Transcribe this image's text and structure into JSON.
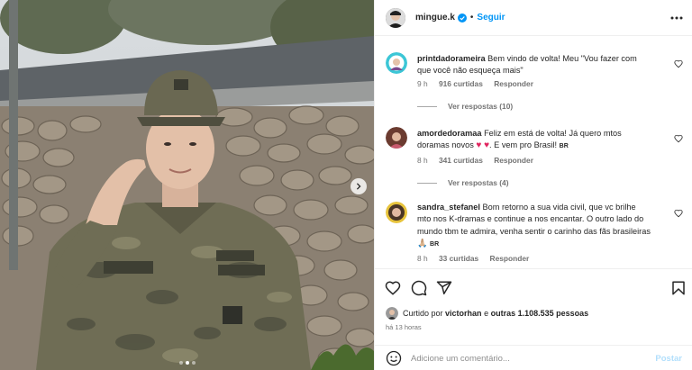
{
  "post": {
    "username": "mingue.k",
    "separator": "•",
    "follow_label": "Seguir",
    "carousel_pages": 3,
    "carousel_active": 1
  },
  "comments": [
    {
      "username": "printdadorameira",
      "text": "Bem vindo de volta! Meu \"Vou fazer com que você não esqueça mais\"",
      "time": "9 h",
      "likes": "916 curtidas",
      "reply_label": "Responder",
      "view_replies": "Ver respostas (10)"
    },
    {
      "username": "amordedoramaa",
      "text_before": "Feliz em está de volta! Já quero mtos doramas novos",
      "hearts": "♥ ♥",
      "text_after": ". E vem pro Brasil!",
      "flag": "BR",
      "time": "8 h",
      "likes": "341 curtidas",
      "reply_label": "Responder",
      "view_replies": "Ver respostas (4)"
    },
    {
      "username": "sandra_stefanel",
      "text": "Bom retorno a sua vida civil, que vc brilhe mto nos K-dramas e continue a nos encantar. O outro lado do mundo tbm te admira, venha sentir o carinho das fãs brasileiras",
      "emoji": "🙏🏼",
      "flag": "BR",
      "time": "8 h",
      "likes": "33 curtidas",
      "reply_label": "Responder"
    }
  ],
  "footer": {
    "liked_prefix": "Curtido por",
    "liked_user": "victorhan",
    "liked_middle": "e",
    "liked_others": "outras 1.108.535 pessoas",
    "time_ago": "há 13 horas",
    "comment_placeholder": "Adicione um comentário...",
    "post_label": "Postar"
  },
  "colors": {
    "accent": "#0095f6",
    "post_disabled": "#b2dffc",
    "muted": "#737373",
    "heart": "#e0245e"
  },
  "icons": [
    "verified-badge-icon",
    "more-options-icon",
    "heart-icon",
    "comment-icon",
    "share-icon",
    "bookmark-icon",
    "emoji-icon",
    "chevron-right-icon"
  ]
}
